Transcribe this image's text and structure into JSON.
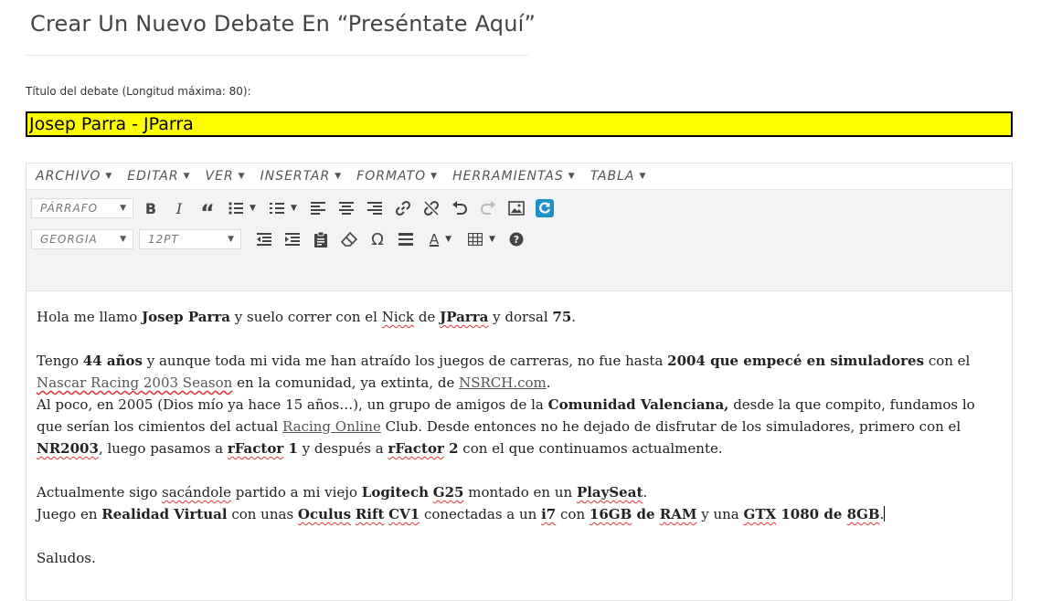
{
  "page": {
    "title": "Crear Un Nuevo Debate En “Preséntate Aquí”"
  },
  "form": {
    "title_label": "Título del debate (Longitud máxima: 80):",
    "title_value": "Josep Parra - JParra"
  },
  "editor": {
    "menubar": [
      {
        "label": "Archivo"
      },
      {
        "label": "Editar"
      },
      {
        "label": "Ver"
      },
      {
        "label": "Insertar"
      },
      {
        "label": "Formato"
      },
      {
        "label": "Herramientas"
      },
      {
        "label": "Tabla"
      }
    ],
    "toolbar": {
      "block_format": "Párrafo",
      "font_family": "Georgia",
      "font_size": "12pt"
    },
    "content": {
      "p1": {
        "t1": "Hola me llamo ",
        "b1": "Josep Parra",
        "t2": " y suelo correr con el ",
        "s1": "Nick",
        "t3": " de ",
        "b2": "JParra",
        "t4": " y dorsal ",
        "b3": "75",
        "t5": "."
      },
      "p2": {
        "t1": "Tengo ",
        "b1": "44 años",
        "t2": " y aunque toda mi vida me han atraído los juegos de carreras, no fue hasta ",
        "b2": "2004 que empecé en simuladores",
        "t3": " con el ",
        "l1": "Nascar Racing 2003 Season",
        "t4": " en la comunidad, ya extinta, de ",
        "l2": "NSRCH.com",
        "t5": ".",
        "t6": "Al poco, en 2005 (Dios mío ya hace 15 años…), un grupo de amigos de la ",
        "b3": "Comunidad Valenciana,",
        "t7": " desde la que compito, fundamos lo que serían los cimientos del actual ",
        "l3": "Racing Online",
        "t8": " Club. Desde entonces no he dejado de disfrutar de los simuladores, primero con el ",
        "b4": "NR2003",
        "t9": ", luego pasamos a ",
        "b5": "rFactor",
        "b6": " 1",
        "t10": " y después a ",
        "b7": "rFactor",
        "b8": " 2",
        "t11": " con el que continuamos actualmente."
      },
      "p3": {
        "t1": "Actualmente sigo ",
        "s1": "sacándole",
        "t2": " partido a mi viejo ",
        "b1": "Logitech",
        "b2": "G25",
        "t3": " montado en un ",
        "b3": "PlaySeat",
        "t4": ".",
        "t5": "Juego en ",
        "b4": "Realidad Virtual",
        "t6": " con unas ",
        "b5": "Oculus",
        "b6": "Rift",
        "b7": "CV1",
        "t7": " conectadas a un ",
        "b8": "i7",
        "t8": " con ",
        "b9": "16GB",
        "b10": " de ",
        "b11": "RAM",
        "t9": " y una ",
        "b12": "GTX",
        "b13": " 1080 de ",
        "b14": "8GB",
        "t10": "."
      },
      "p4": {
        "t1": "Saludos."
      }
    }
  },
  "colors": {
    "title_input_bg": "#ffff00",
    "toolbar_bg": "#f3f3f3",
    "refresh_icon": "#1e90c8",
    "spell_error": "#d33"
  }
}
